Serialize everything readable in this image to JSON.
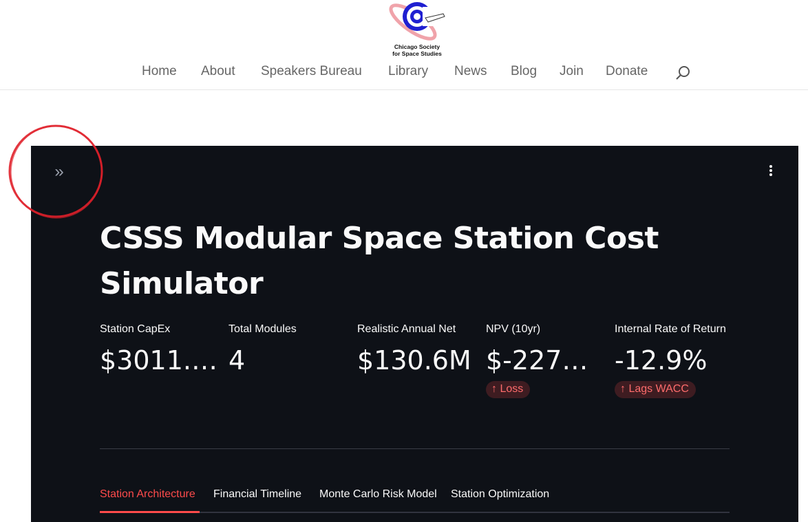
{
  "site": {
    "logo_line1": "Chicago Society",
    "logo_line2": "for Space Studies",
    "nav": [
      "Home",
      "About",
      "Speakers Bureau",
      "Library",
      "News",
      "Blog",
      "Join",
      "Donate"
    ],
    "search_icon": "search-icon"
  },
  "app": {
    "expand_icon": "»",
    "title": "CSSS Modular Space Station Cost Simulator",
    "metrics": [
      {
        "label": "Station CapEx",
        "value": "$3011.…",
        "delta": ""
      },
      {
        "label": "Total Modules",
        "value": "4",
        "delta": ""
      },
      {
        "label": "Realistic Annual Net",
        "value": "$130.6M",
        "delta": ""
      },
      {
        "label": "NPV (10yr)",
        "value": "$-227…",
        "delta": "↑ Loss"
      },
      {
        "label": "Internal Rate of Return",
        "value": "-12.9%",
        "delta": "↑ Lags WACC"
      }
    ],
    "tabs": [
      "Station Architecture",
      "Financial Timeline",
      "Monte Carlo Risk Model",
      "Station Optimization"
    ],
    "active_tab": "Station Architecture"
  },
  "colors": {
    "app_bg": "#0e1117",
    "accent": "#ff4b4b",
    "nav_text": "#666666",
    "annotation": "#e0202a"
  }
}
